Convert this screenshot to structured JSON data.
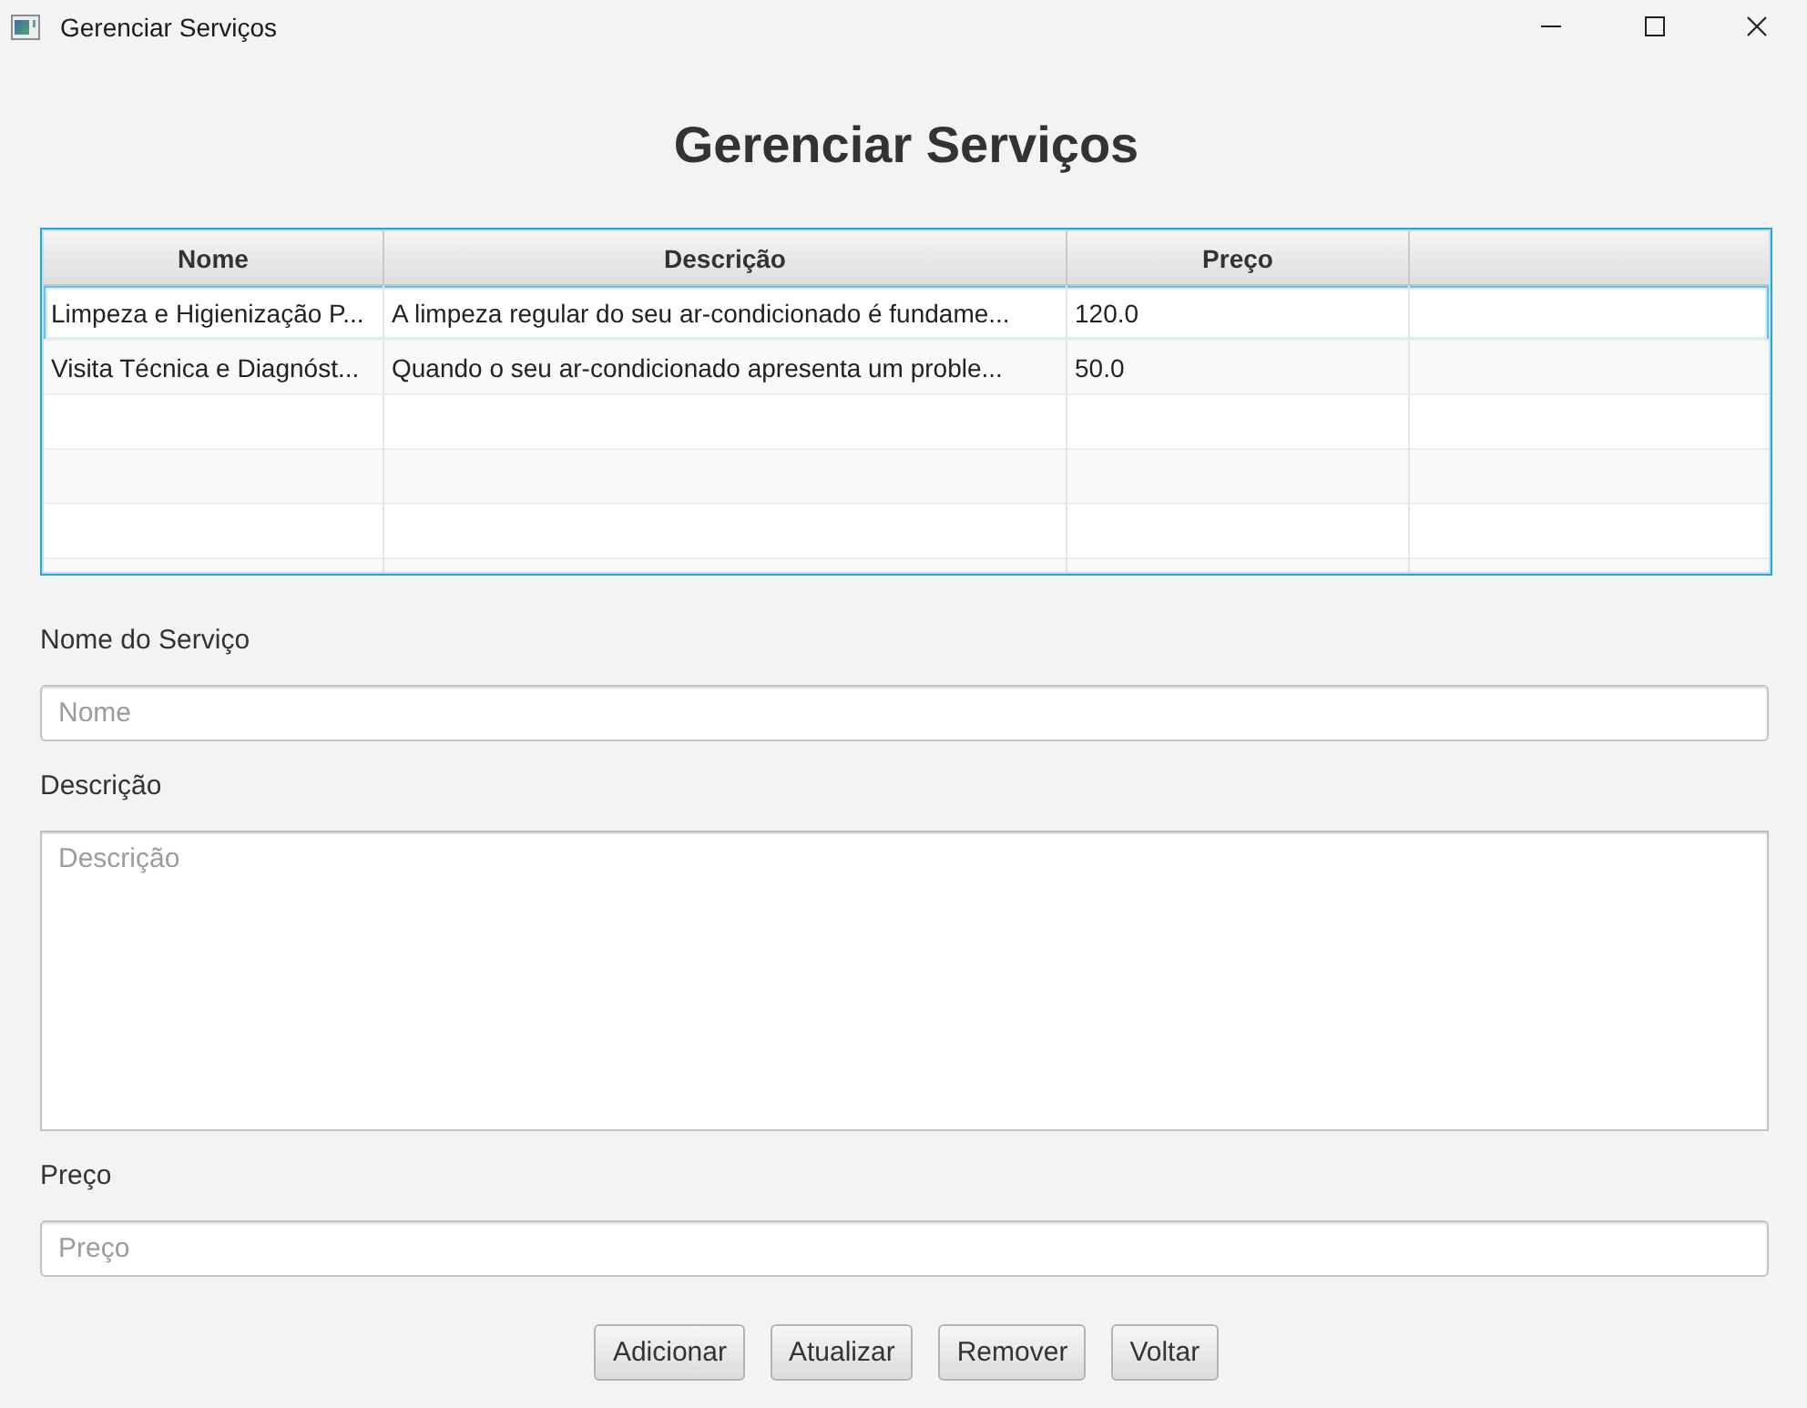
{
  "window": {
    "title": "Gerenciar Serviços"
  },
  "heading": "Gerenciar Serviços",
  "table": {
    "focused": true,
    "columns": [
      "Nome",
      "Descrição",
      "Preço"
    ],
    "rows": [
      {
        "selected": true,
        "cells": [
          "Limpeza e Higienização P...",
          "A limpeza regular do seu ar-condicionado é fundame...",
          "120.0"
        ]
      },
      {
        "selected": false,
        "cells": [
          "Visita Técnica e Diagnóst...",
          "Quando o seu ar-condicionado apresenta um proble...",
          "50.0"
        ]
      }
    ]
  },
  "form": {
    "fields": [
      {
        "kind": "input",
        "label": "Nome do Serviço",
        "placeholder": "Nome"
      },
      {
        "kind": "textarea",
        "label": "Descrição",
        "placeholder": "Descrição"
      },
      {
        "kind": "input",
        "label": "Preço",
        "placeholder": "Preço"
      }
    ]
  },
  "buttons": [
    "Adicionar",
    "Atualizar",
    "Remover",
    "Voltar"
  ]
}
